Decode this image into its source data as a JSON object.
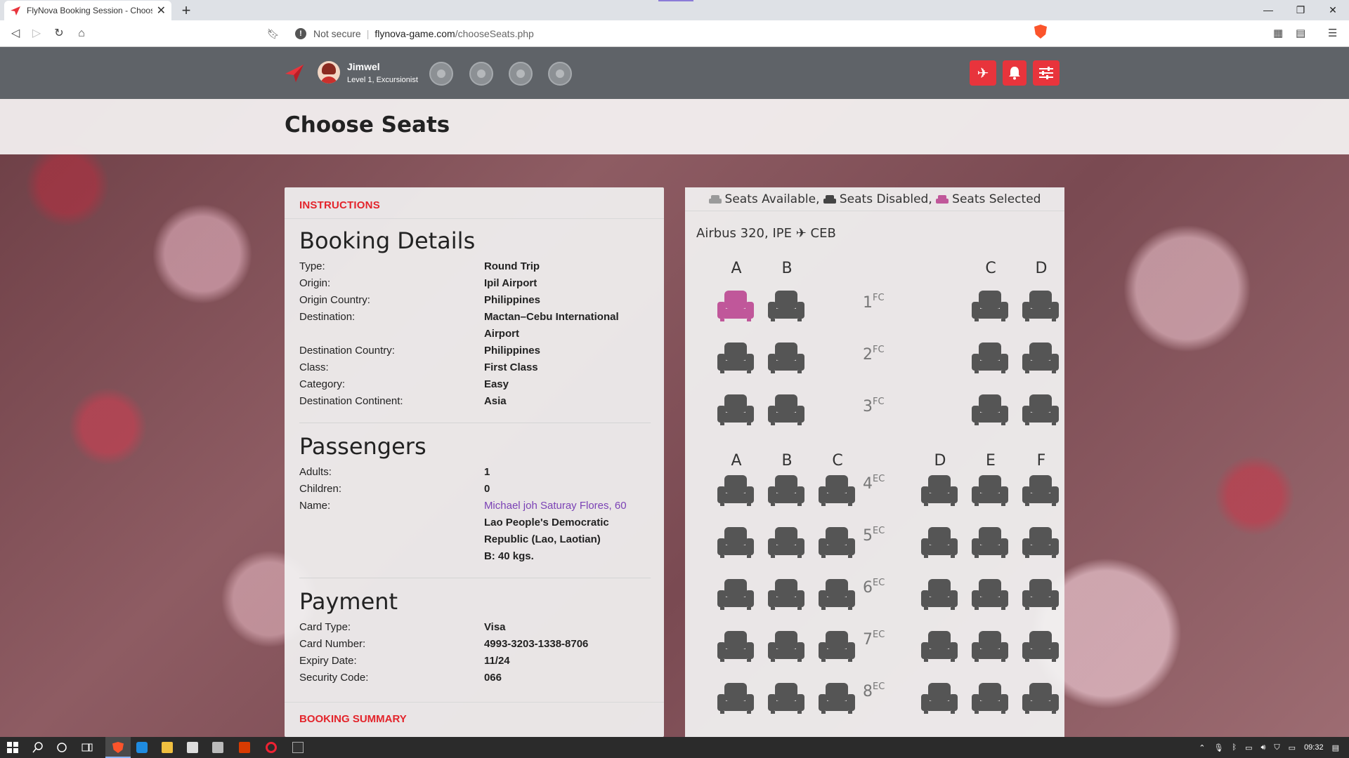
{
  "browser": {
    "tab_title": "FlyNova Booking Session - Choose",
    "url_secure": "Not secure",
    "url_host": "flynova-game.com",
    "url_path": "/chooseSeats.php"
  },
  "appbar": {
    "user_name": "Jimwel",
    "user_level": "Level 1, Excursionist"
  },
  "page_title": "Choose Seats",
  "instructions_label": "INSTRUCTIONS",
  "booking": {
    "title": "Booking Details",
    "rows": [
      {
        "k": "Type:",
        "v": "Round Trip"
      },
      {
        "k": "Origin:",
        "v": "Ipil Airport"
      },
      {
        "k": "Origin Country:",
        "v": "Philippines"
      },
      {
        "k": "Destination:",
        "v": "Mactan–Cebu International Airport"
      },
      {
        "k": "Destination Country:",
        "v": "Philippines"
      },
      {
        "k": "Class:",
        "v": "First Class"
      },
      {
        "k": "Category:",
        "v": "Easy"
      },
      {
        "k": "Destination Continent:",
        "v": "Asia"
      }
    ]
  },
  "passengers": {
    "title": "Passengers",
    "adults_label": "Adults:",
    "adults": "1",
    "children_label": "Children:",
    "children": "0",
    "name_label": "Name:",
    "name": "Michael joh Saturay Flores, 60",
    "nationality": "Lao People's Democratic Republic (Lao, Laotian)",
    "baggage": "B: 40 kgs."
  },
  "payment": {
    "title": "Payment",
    "rows": [
      {
        "k": "Card Type:",
        "v": "Visa"
      },
      {
        "k": "Card Number:",
        "v": "4993-3203-1338-8706"
      },
      {
        "k": "Expiry Date:",
        "v": "11/24"
      },
      {
        "k": "Security Code:",
        "v": "066"
      }
    ]
  },
  "booking_summary_label": "BOOKING SUMMARY",
  "seatmap": {
    "legend_available": "Seats Available,",
    "legend_disabled": "Seats Disabled,",
    "legend_selected": "Seats Selected",
    "plane": "Airbus 320, IPE ✈ CEB",
    "fc_letters": [
      "A",
      "B",
      "C",
      "D"
    ],
    "ec_letters": [
      "A",
      "B",
      "C",
      "D",
      "E",
      "F"
    ],
    "fc_suffix": "FC",
    "ec_suffix": "EC",
    "fc_rows": [
      "1",
      "2",
      "3"
    ],
    "ec_rows": [
      "4",
      "5",
      "6",
      "7",
      "8"
    ],
    "selected_seat": "1A",
    "colors": {
      "available": "#555555",
      "selected": "#c0579a",
      "disabled": "#444444"
    }
  },
  "taskbar": {
    "time": "09:32"
  }
}
